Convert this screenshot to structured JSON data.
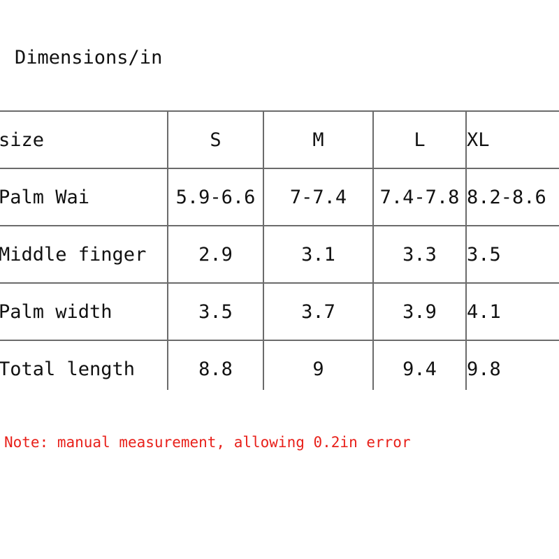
{
  "title": "Dimensions/in",
  "table": {
    "columns": [
      "size",
      "S",
      "M",
      "L",
      "XL"
    ],
    "rows": [
      {
        "label": "Palm Wai",
        "S": "5.9-6.6",
        "M": "7-7.4",
        "L": "7.4-7.8",
        "XL": "8.2-8.6"
      },
      {
        "label": "Middle finger",
        "S": "2.9",
        "M": "3.1",
        "L": "3.3",
        "XL": "3.5"
      },
      {
        "label": "Palm width",
        "S": "3.5",
        "M": "3.7",
        "L": "3.9",
        "XL": "4.1"
      },
      {
        "label": "Total length",
        "S": "8.8",
        "M": "9",
        "L": "9.4",
        "XL": "9.8"
      }
    ]
  },
  "note": "Note: manual measurement, allowing 0.2in error",
  "colors": {
    "note_red": "#e8201a",
    "border_gray": "#6b6b6b",
    "text_black": "#111111",
    "background": "#ffffff"
  }
}
